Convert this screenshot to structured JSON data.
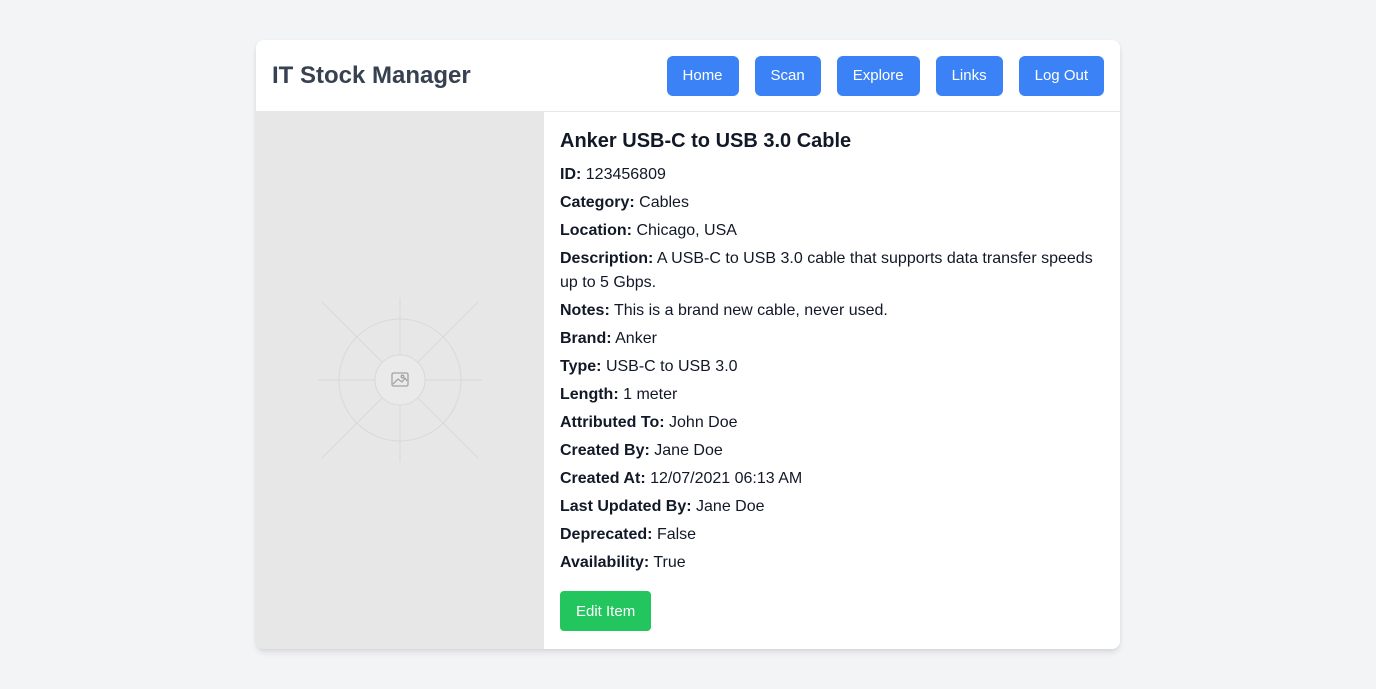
{
  "app": {
    "title": "IT Stock Manager"
  },
  "nav": {
    "home": "Home",
    "scan": "Scan",
    "explore": "Explore",
    "links": "Links",
    "logout": "Log Out"
  },
  "item": {
    "name": "Anker USB-C to USB 3.0 Cable",
    "image_icon": "image-placeholder-icon",
    "fields": [
      {
        "label": "ID:",
        "value": "123456809"
      },
      {
        "label": "Category:",
        "value": "Cables"
      },
      {
        "label": "Location:",
        "value": "Chicago, USA"
      },
      {
        "label": "Description:",
        "value": "A USB-C to USB 3.0 cable that supports data transfer speeds up to 5 Gbps."
      },
      {
        "label": "Notes:",
        "value": "This is a brand new cable, never used."
      },
      {
        "label": "Brand:",
        "value": "Anker"
      },
      {
        "label": "Type:",
        "value": "USB-C to USB 3.0"
      },
      {
        "label": "Length:",
        "value": "1 meter"
      },
      {
        "label": "Attributed To:",
        "value": "John Doe"
      },
      {
        "label": "Created By:",
        "value": "Jane Doe"
      },
      {
        "label": "Created At:",
        "value": "12/07/2021 06:13 AM"
      },
      {
        "label": "Last Updated By:",
        "value": "Jane Doe"
      },
      {
        "label": "Deprecated:",
        "value": "False"
      },
      {
        "label": "Availability:",
        "value": "True"
      }
    ],
    "edit_label": "Edit Item"
  },
  "colors": {
    "primary": "#3b82f6",
    "success": "#22c55e",
    "background": "#f3f4f6",
    "title_text": "#374151"
  }
}
